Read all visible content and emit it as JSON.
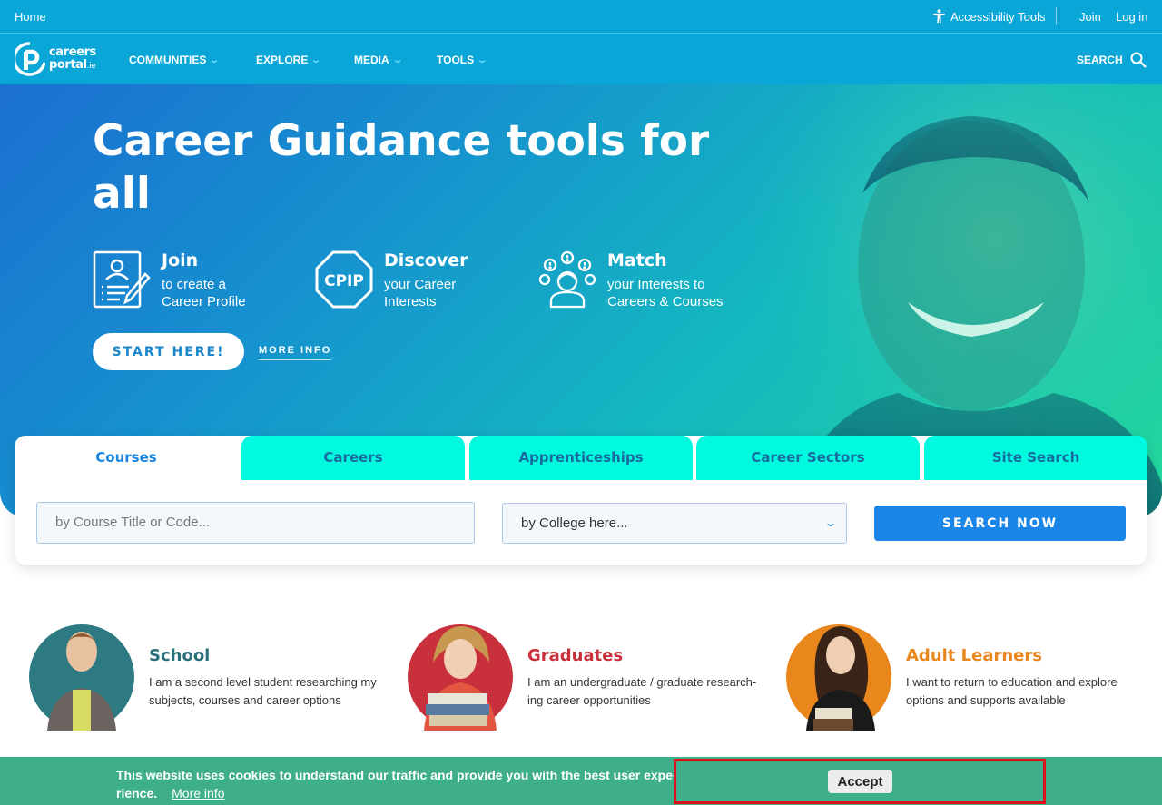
{
  "topbar": {
    "home": "Home",
    "accessibility": "Accessibility Tools",
    "join": "Join",
    "login": "Log in"
  },
  "logo": {
    "line1": "careers",
    "line2": "portal",
    "suffix": ".ie"
  },
  "nav": {
    "items": [
      {
        "label": "COMMUNITIES"
      },
      {
        "label": "EXPLORE"
      },
      {
        "label": "MEDIA"
      },
      {
        "label": "TOOLS"
      }
    ],
    "search": "SEARCH"
  },
  "hero": {
    "title": "Career Guidance tools for all",
    "features": [
      {
        "title": "Join",
        "line1": "to create a",
        "line2": "Career Profile",
        "icon": "profile-form-icon"
      },
      {
        "title": "Discover",
        "line1": "your Career",
        "line2": "Interests",
        "icon": "cpip-icon",
        "icon_text": "CPIP"
      },
      {
        "title": "Match",
        "line1": "your Interests to",
        "line2": "Careers & Courses",
        "icon": "match-person-icon"
      }
    ],
    "start_button": "START HERE!",
    "more_info": "MORE INFO"
  },
  "search_panel": {
    "tabs": [
      {
        "label": "Courses",
        "active": true
      },
      {
        "label": "Careers",
        "active": false
      },
      {
        "label": "Apprenticeships",
        "active": false
      },
      {
        "label": "Career Sectors",
        "active": false
      },
      {
        "label": "Site Search",
        "active": false
      }
    ],
    "course_placeholder": "by Course Title or Code...",
    "college_select": "by College here...",
    "search_button": "SEARCH NOW"
  },
  "audiences": [
    {
      "title": "School",
      "desc": "I am a second level student researching my subjects, courses and career options",
      "color": "#2a6f7a"
    },
    {
      "title": "Graduates",
      "desc": "I am an undergraduate / graduate research-ing career opportunities",
      "color": "#c8313b"
    },
    {
      "title": "Adult Learners",
      "desc": "I want to return to education and explore options and supports available",
      "color": "#e9861c"
    }
  ],
  "cookie": {
    "text": "This website uses cookies to understand our traffic and provide you with the best user expe-rience.",
    "more": "More info",
    "accept": "Accept"
  },
  "colors": {
    "brand_blue": "#0aa6d8",
    "tab_cyan": "#00fadf",
    "button_blue": "#1a86e8",
    "cookie_green": "#3eaf8a",
    "highlight_red": "#e0101a"
  }
}
